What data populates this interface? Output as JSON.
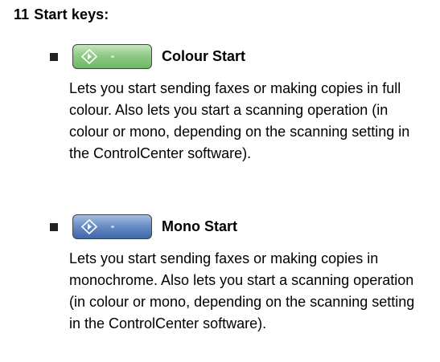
{
  "section": {
    "number": "11",
    "title": "Start keys:"
  },
  "items": [
    {
      "label": "Colour Start",
      "key_icon": "start-diamond-icon",
      "key_color": "#8fcb85",
      "description": "Lets you start sending faxes or making copies in full colour. Also lets you start a scanning operation (in colour or mono, depending on the scanning setting in the ControlCenter software)."
    },
    {
      "label": "Mono Start",
      "key_icon": "start-diamond-icon",
      "key_color": "#6a8fc6",
      "description": "Lets you start sending faxes or making copies in monochrome. Also lets you start a scanning operation (in colour or mono, depending on the scanning setting in the ControlCenter software)."
    }
  ]
}
